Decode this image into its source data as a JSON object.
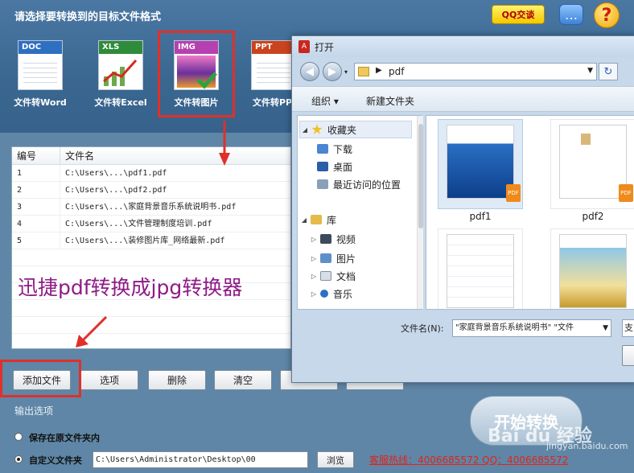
{
  "app": {
    "title": "请选择要转换到的目标文件格式",
    "qq_button": "QQ交谈",
    "formats": [
      {
        "tag": "DOC",
        "label": "文件转Word",
        "color": "#2f6fc1"
      },
      {
        "tag": "XLS",
        "label": "文件转Excel",
        "color": "#2e8b3a"
      },
      {
        "tag": "IMG",
        "label": "文件转图片",
        "color": "#b541b0"
      },
      {
        "tag": "PPT",
        "label": "文件转PP",
        "color": "#c9441d"
      }
    ],
    "list": {
      "headers": [
        "编号",
        "文件名"
      ],
      "rows": [
        {
          "no": "1",
          "name": "C:\\Users\\...\\pdf1.pdf"
        },
        {
          "no": "2",
          "name": "C:\\Users\\...\\pdf2.pdf"
        },
        {
          "no": "3",
          "name": "C:\\Users\\...\\家庭背景音乐系统说明书.pdf"
        },
        {
          "no": "4",
          "name": "C:\\Users\\...\\文件管理制度培训.pdf"
        },
        {
          "no": "5",
          "name": "C:\\Users\\...\\装修图片库_网络最新.pdf"
        }
      ]
    },
    "overlay_text": "迅捷pdf转换成jpg转换器",
    "buttons": {
      "add": "添加文件",
      "options": "选项",
      "delete": "删除",
      "clear": "清空"
    },
    "output": {
      "title": "输出选项",
      "opt_same": "保存在原文件夹内",
      "opt_custom": "自定义文件夹",
      "path": "C:\\Users\\Administrator\\Desktop\\00",
      "browse": "浏览"
    },
    "hotline": "客服热线：4006685572 QQ：4006685572",
    "start_button": "开始转换",
    "watermark": "Bai du 经验",
    "watermark_sub": "jingyan.baidu.com"
  },
  "dialog": {
    "title": "打开",
    "address": "pdf",
    "organize": "组织 ▾",
    "new_folder": "新建文件夹",
    "nav": {
      "favorites": "收藏夹",
      "downloads": "下载",
      "desktop": "桌面",
      "recent": "最近访问的位置",
      "library": "库",
      "videos": "视频",
      "pictures": "图片",
      "documents": "文档",
      "music": "音乐"
    },
    "files": [
      "pdf1",
      "pdf2"
    ],
    "filename_label": "文件名(N):",
    "filename_value": "\"家庭背景音乐系统说明书\" \"文件",
    "type_box": "支"
  }
}
